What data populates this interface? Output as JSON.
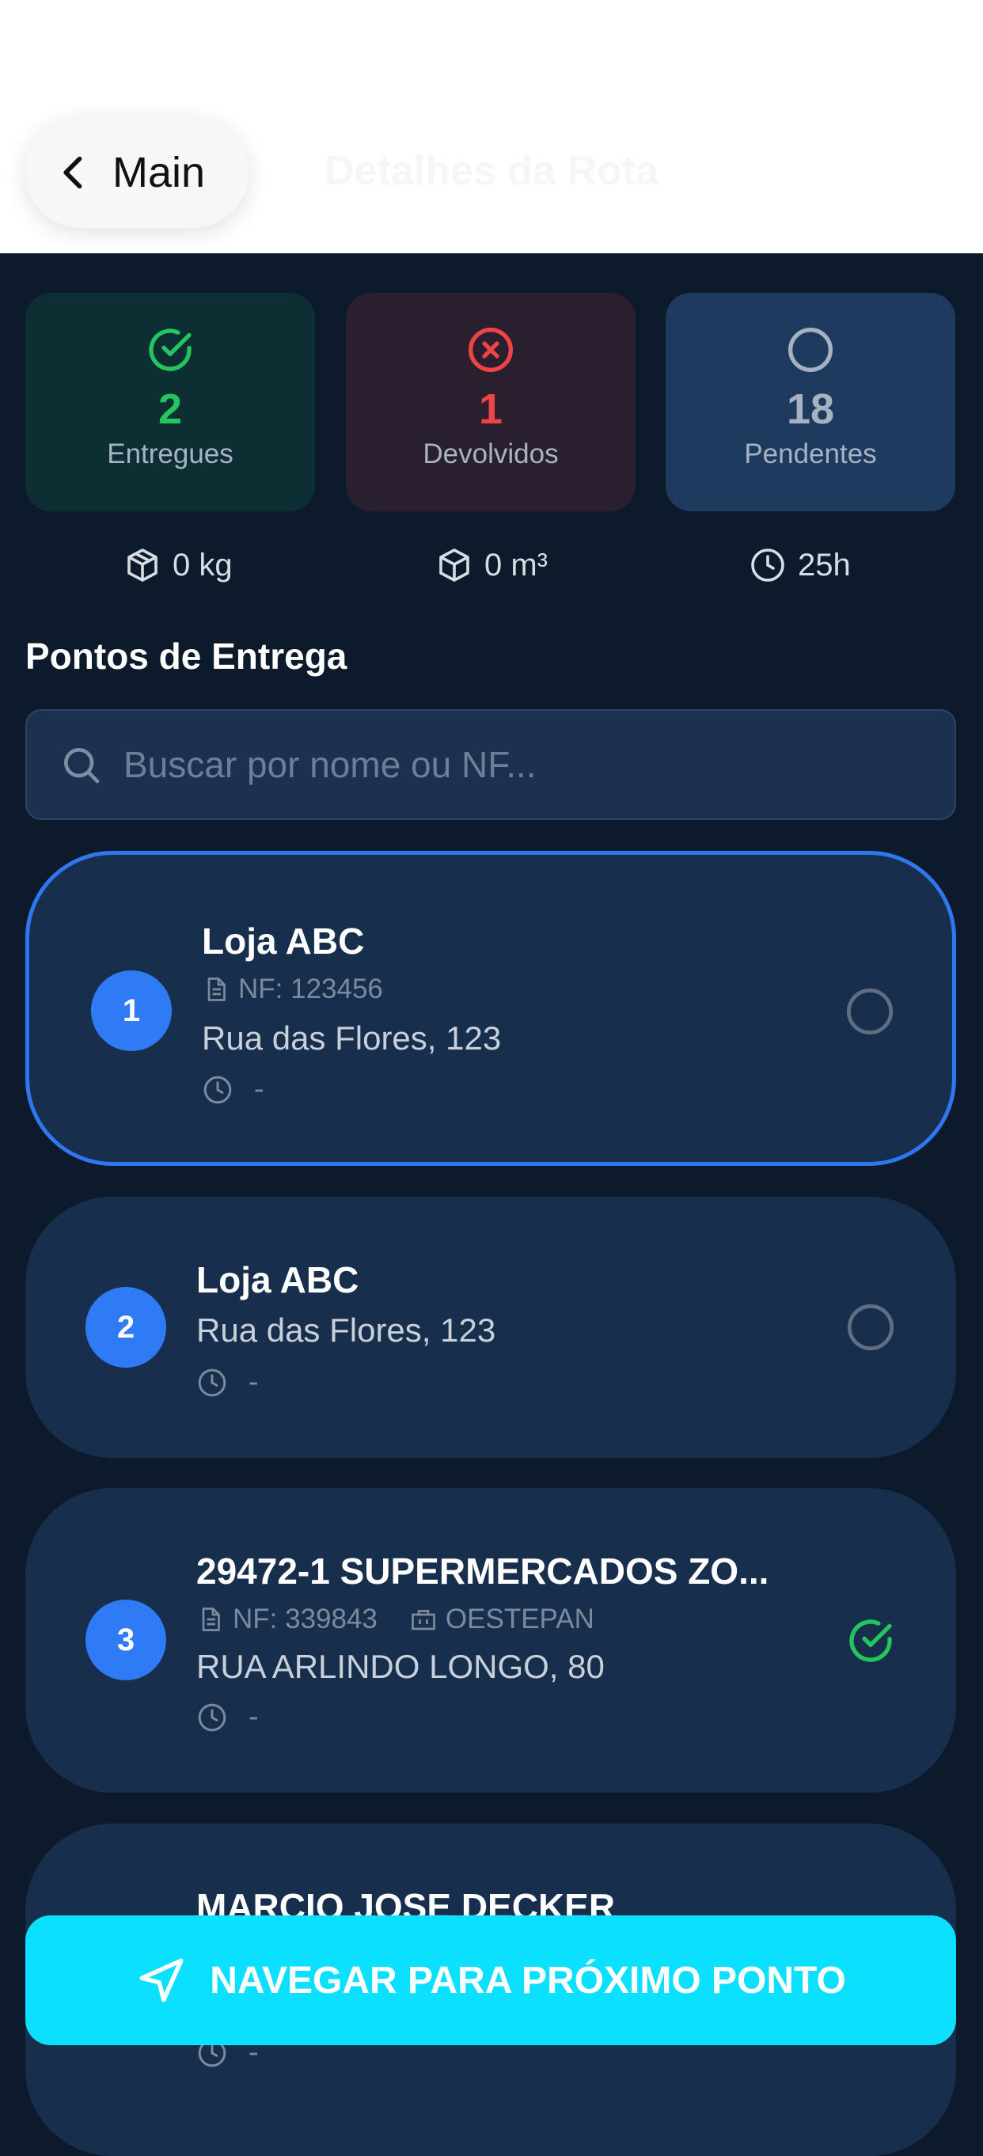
{
  "header": {
    "back_label": "Main",
    "title": "Detalhes da Rota"
  },
  "stats": [
    {
      "value": "2",
      "label": "Entregues",
      "icon": "check-circle-icon",
      "color": "#22c55e",
      "bg": "#0d2e33"
    },
    {
      "value": "1",
      "label": "Devolvidos",
      "icon": "x-circle-icon",
      "color": "#ef4444",
      "bg": "#2a1f2f"
    },
    {
      "value": "18",
      "label": "Pendentes",
      "icon": "circle-icon",
      "color": "#a6b1c1",
      "bg": "#1f3a5f"
    }
  ],
  "metrics": {
    "weight": "0 kg",
    "volume": "0 m³",
    "duration": "25h"
  },
  "section_title": "Pontos de Entrega",
  "search": {
    "placeholder": "Buscar por nome ou NF..."
  },
  "stops": [
    {
      "number": "1",
      "name": "Loja ABC",
      "nf": "NF: 123456",
      "address": "Rua das Flores, 123",
      "time": "-",
      "status": "pending"
    },
    {
      "number": "2",
      "name": "Loja ABC",
      "address": "Rua das Flores, 123",
      "time": "-",
      "status": "pending"
    },
    {
      "number": "3",
      "name": "29472-1 SUPERMERCADOS ZO...",
      "nf": "NF: 339843",
      "company": "OESTEPAN",
      "address": "RUA ARLINDO LONGO, 80",
      "time": "-",
      "status": "delivered"
    },
    {
      "name": "MARCIO JOSE DECKER",
      "time": "-"
    }
  ],
  "nav_button": {
    "label": "NAVEGAR PARA PRÓXIMO PONTO"
  },
  "colors": {
    "accent": "#0ce0ff",
    "number_badge": "#2f7bf5",
    "selected_border": "#2f77f0",
    "delivered": "#22c55e"
  }
}
